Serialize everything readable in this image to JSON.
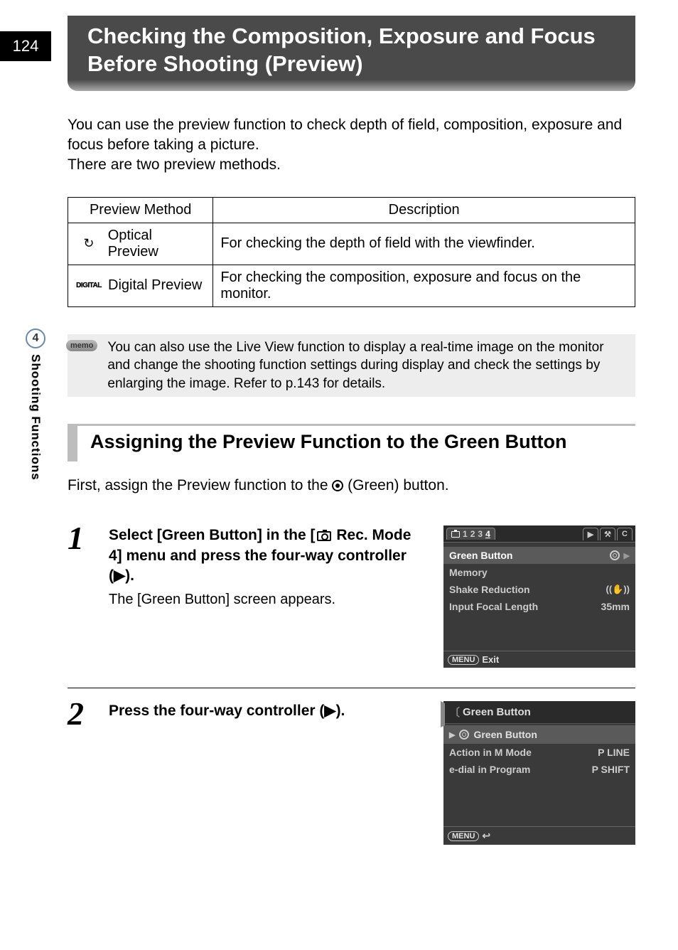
{
  "page_number": "124",
  "title": "Checking the Composition, Exposure and Focus Before Shooting (Preview)",
  "intro": "You can use the preview function to check depth of field, composition, exposure and focus before taking a picture.\nThere are two preview methods.",
  "table": {
    "headers": [
      "Preview Method",
      "Description"
    ],
    "rows": [
      {
        "icon": "↻",
        "method": "Optical Preview",
        "desc": "For checking the depth of field with the viewfinder."
      },
      {
        "icon": "DIGITAL",
        "method": "Digital Preview",
        "desc": "For checking the composition, exposure and focus on the monitor."
      }
    ]
  },
  "memo": {
    "label": "memo",
    "text": "You can also use the Live View function to display a real-time image on the monitor and change the shooting function settings during display and check the settings by enlarging the image. Refer to p.143 for details."
  },
  "side": {
    "chapter": "4",
    "label": "Shooting Functions"
  },
  "section_heading": "Assigning the Preview Function to the Green Button",
  "section_intro_pre": "First, assign the Preview function to the ",
  "section_intro_post": " (Green) button.",
  "steps": [
    {
      "num": "1",
      "title_pre": "Select [Green Button] in the [",
      "title_mid": " Rec. Mode 4] menu and press the four-way controller (",
      "title_arrow": "▶",
      "title_post": ").",
      "body": "The [Green Button] screen appears."
    },
    {
      "num": "2",
      "title_pre": "Press the four-way controller (",
      "title_arrow": "▶",
      "title_post": ")."
    }
  ],
  "lcd1": {
    "tabs_nums": [
      "1",
      "2",
      "3",
      "4"
    ],
    "tabs_right": [
      "▶",
      "⚒",
      "C"
    ],
    "rows": [
      {
        "label": "Green Button",
        "value_icon": "ring",
        "hl": true
      },
      {
        "label": "Memory",
        "value": ""
      },
      {
        "label": "Shake Reduction",
        "value_icon": "shake"
      },
      {
        "label": "Input Focal Length",
        "value": "35mm"
      }
    ],
    "footer_menu": "MENU",
    "footer_text": "Exit"
  },
  "lcd2": {
    "title": "Green Button",
    "sel_label": "Green Button",
    "rows": [
      {
        "label": "Action in M Mode",
        "value": "P LINE"
      },
      {
        "label": "e-dial in Program",
        "value": "P SHIFT"
      }
    ],
    "footer_menu": "MENU"
  }
}
